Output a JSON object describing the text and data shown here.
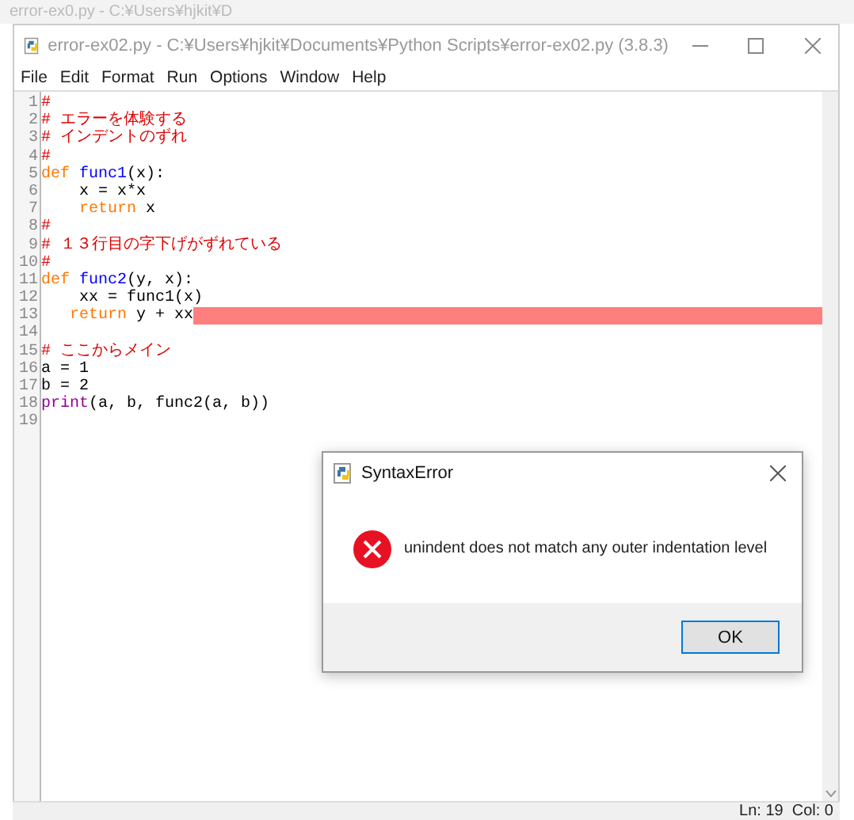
{
  "background_window": {
    "title": "error-ex0.py - C:¥Users¥hjkit¥D"
  },
  "window": {
    "title": "error-ex02.py - C:¥Users¥hjkit¥Documents¥Python Scripts¥error-ex02.py (3.8.3)"
  },
  "menu": [
    "File",
    "Edit",
    "Format",
    "Run",
    "Options",
    "Window",
    "Help"
  ],
  "lines": [
    {
      "number": "1",
      "highlighted": false,
      "tokens": [
        {
          "kind": "comment",
          "text": "#"
        }
      ]
    },
    {
      "number": "2",
      "highlighted": false,
      "tokens": [
        {
          "kind": "comment",
          "text": "# エラーを体験する"
        }
      ]
    },
    {
      "number": "3",
      "highlighted": false,
      "tokens": [
        {
          "kind": "comment",
          "text": "# インデントのずれ"
        }
      ]
    },
    {
      "number": "4",
      "highlighted": false,
      "tokens": [
        {
          "kind": "comment",
          "text": "#"
        }
      ]
    },
    {
      "number": "5",
      "highlighted": false,
      "tokens": [
        {
          "kind": "keyword",
          "text": "def "
        },
        {
          "kind": "definition",
          "text": "func1"
        },
        {
          "kind": "plain",
          "text": "(x):"
        }
      ]
    },
    {
      "number": "6",
      "highlighted": false,
      "tokens": [
        {
          "kind": "plain",
          "text": "    x = x*x"
        }
      ]
    },
    {
      "number": "7",
      "highlighted": false,
      "tokens": [
        {
          "kind": "keyword",
          "text": "    return"
        },
        {
          "kind": "plain",
          "text": " x"
        }
      ]
    },
    {
      "number": "8",
      "highlighted": false,
      "tokens": [
        {
          "kind": "comment",
          "text": "#"
        }
      ]
    },
    {
      "number": "9",
      "highlighted": false,
      "tokens": [
        {
          "kind": "comment",
          "text": "# １３行目の字下げがずれている"
        }
      ]
    },
    {
      "number": "10",
      "highlighted": false,
      "tokens": [
        {
          "kind": "comment",
          "text": "#"
        }
      ]
    },
    {
      "number": "11",
      "highlighted": false,
      "tokens": [
        {
          "kind": "keyword",
          "text": "def "
        },
        {
          "kind": "definition",
          "text": "func2"
        },
        {
          "kind": "plain",
          "text": "(y, x):"
        }
      ]
    },
    {
      "number": "12",
      "highlighted": false,
      "tokens": [
        {
          "kind": "plain",
          "text": "    xx = func1(x)"
        }
      ]
    },
    {
      "number": "13",
      "highlighted": true,
      "tokens": [
        {
          "kind": "keyword",
          "text": "   return"
        },
        {
          "kind": "plain",
          "text": " y + xx"
        }
      ]
    },
    {
      "number": "14",
      "highlighted": false
    },
    {
      "number": "15",
      "highlighted": false,
      "tokens": [
        {
          "kind": "comment",
          "text": "# ここからメイン"
        }
      ]
    },
    {
      "number": "16",
      "highlighted": false,
      "tokens": [
        {
          "kind": "plain",
          "text": "a = 1"
        }
      ]
    },
    {
      "number": "17",
      "highlighted": false,
      "tokens": [
        {
          "kind": "plain",
          "text": "b = 2"
        }
      ]
    },
    {
      "number": "18",
      "highlighted": false,
      "tokens": [
        {
          "kind": "builtin",
          "text": "print"
        },
        {
          "kind": "plain",
          "text": "(a, b, func2(a, b))"
        }
      ]
    },
    {
      "number": "19",
      "highlighted": false
    }
  ],
  "status_bar": {
    "position": "Ln: 19  Col: 0"
  },
  "dialog": {
    "title": "SyntaxError",
    "message": "unindent does not match any outer indentation level",
    "button": "OK"
  }
}
